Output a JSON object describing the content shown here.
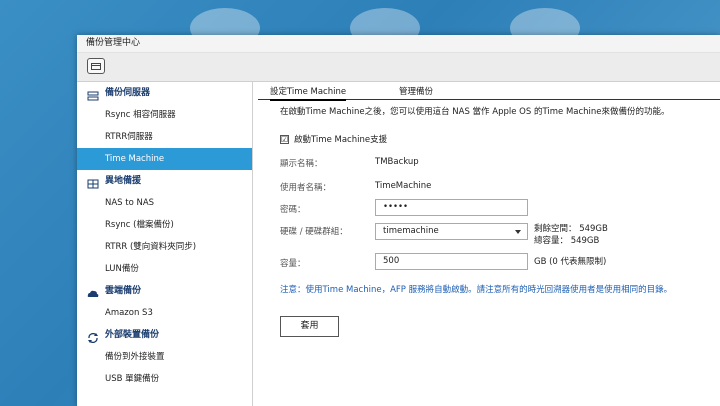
{
  "window": {
    "title": "備份管理中心"
  },
  "sidebar": {
    "groups": [
      {
        "label": "備份伺服器",
        "icon": "server-icon",
        "items": [
          "Rsync 相容伺服器",
          "RTRR伺服器",
          "Time Machine"
        ]
      },
      {
        "label": "異地備援",
        "icon": "grid-icon",
        "items": [
          "NAS to NAS",
          "Rsync (檔案備份)",
          "RTRR (雙向資料夾同步)",
          "LUN備份"
        ]
      },
      {
        "label": "雲端備份",
        "icon": "cloud-icon",
        "items": [
          "Amazon S3"
        ]
      },
      {
        "label": "外部裝置備份",
        "icon": "sync-icon",
        "items": [
          "備份到外接裝置",
          "USB 單鍵備份"
        ]
      }
    ],
    "active_item": "Time Machine"
  },
  "tabs": {
    "settings": "設定Time Machine",
    "manage": "管理備份"
  },
  "form": {
    "description": "在啟動Time Machine之後，您可以使用這台 NAS 當作 Apple OS 的Time Machine來做備份的功能。",
    "enable_label": "啟動Time Machine支援",
    "enable_checked": "☑",
    "display_name_label": "顯示名稱：",
    "display_name_value": "TMBackup",
    "username_label": "使用者名稱：",
    "username_value": "TimeMachine",
    "password_label": "密碼：",
    "password_value": "•••••",
    "volume_label": "硬碟 / 硬碟群組：",
    "volume_value": "timemachine",
    "free_space": "剩餘空間： 549GB",
    "total_space": "總容量： 549GB",
    "capacity_label": "容量：",
    "capacity_value": "500",
    "capacity_unit": "GB (0 代表無限制)",
    "notice": "注意：使用Time Machine，AFP 服務將自動啟動。請注意所有的時光回溯器使用者是使用相同的目錄。",
    "apply_label": "套用"
  },
  "colors": {
    "accent": "#2d9ad8",
    "notice": "#1d5fb3",
    "category": "#1a3c6e"
  }
}
